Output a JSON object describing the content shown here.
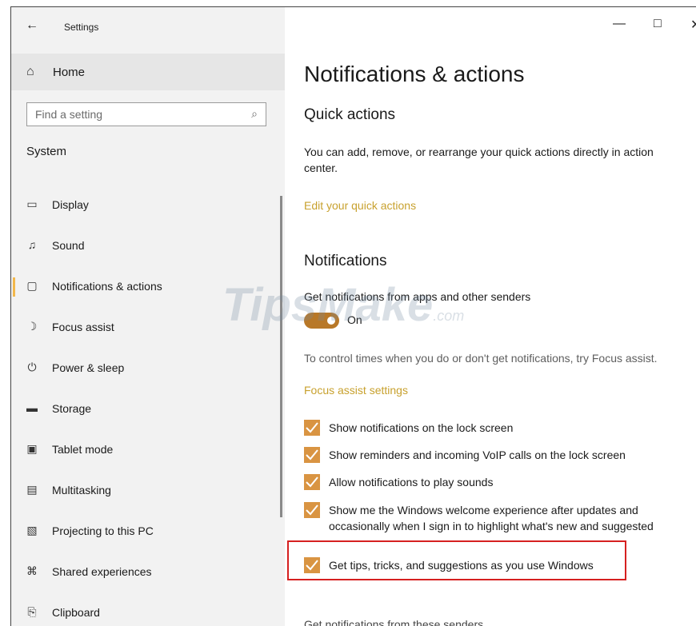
{
  "titlebar": {
    "app_title": "Settings",
    "back_icon": "back-arrow-icon",
    "minimize": "—",
    "maximize": "□",
    "close": "✕"
  },
  "sidebar": {
    "home_label": "Home",
    "search_placeholder": "Find a setting",
    "section_title": "System",
    "items": [
      {
        "label": "Display",
        "icon": "display-icon"
      },
      {
        "label": "Sound",
        "icon": "sound-icon"
      },
      {
        "label": "Notifications & actions",
        "icon": "notifications-icon",
        "active": true
      },
      {
        "label": "Focus assist",
        "icon": "moon-icon"
      },
      {
        "label": "Power & sleep",
        "icon": "power-icon"
      },
      {
        "label": "Storage",
        "icon": "storage-icon"
      },
      {
        "label": "Tablet mode",
        "icon": "tablet-icon"
      },
      {
        "label": "Multitasking",
        "icon": "multitasking-icon"
      },
      {
        "label": "Projecting to this PC",
        "icon": "projecting-icon"
      },
      {
        "label": "Shared experiences",
        "icon": "shared-icon"
      },
      {
        "label": "Clipboard",
        "icon": "clipboard-icon"
      }
    ]
  },
  "main": {
    "page_title": "Notifications & actions",
    "quick_actions": {
      "heading": "Quick actions",
      "description": "You can add, remove, or rearrange your quick actions directly in action center.",
      "link": "Edit your quick actions"
    },
    "notifications": {
      "heading": "Notifications",
      "toggle_caption": "Get notifications from apps and other senders",
      "toggle_state": "On",
      "focus_text": "To control times when you do or don't get notifications, try Focus assist.",
      "focus_link": "Focus assist settings",
      "checkboxes": [
        {
          "label": "Show notifications on the lock screen",
          "checked": true
        },
        {
          "label": "Show reminders and incoming VoIP calls on the lock screen",
          "checked": true
        },
        {
          "label": "Allow notifications to play sounds",
          "checked": true
        },
        {
          "label": "Show me the Windows welcome experience after updates and occasionally when I sign in to highlight what's new and suggested",
          "checked": true
        },
        {
          "label": "Get tips, tricks, and suggestions as you use Windows",
          "checked": true
        }
      ]
    },
    "cutoff_text": "Get notifications from these senders"
  },
  "watermark": {
    "text": "TipsMake",
    "suffix": ".com"
  },
  "colors": {
    "accent": "#d99442",
    "link": "#c8a12e",
    "highlight_border": "#d62020",
    "sidebar_bg": "#f2f2f2"
  }
}
